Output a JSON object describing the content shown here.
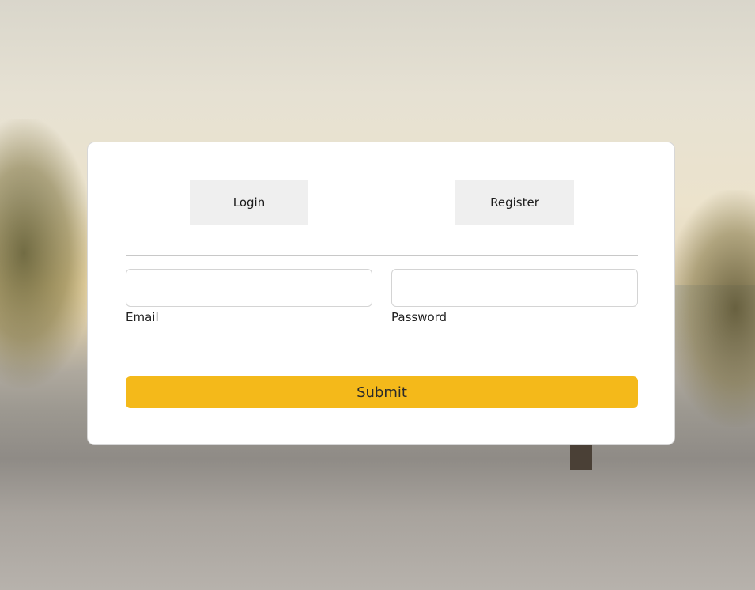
{
  "tabs": {
    "login_label": "Login",
    "register_label": "Register"
  },
  "form": {
    "email": {
      "label": "Email",
      "value": "",
      "placeholder": ""
    },
    "password": {
      "label": "Password",
      "value": "",
      "placeholder": ""
    },
    "submit_label": "Submit"
  },
  "colors": {
    "accent": "#f4b91a",
    "tab_background": "#efefef",
    "card_background": "#ffffff"
  }
}
